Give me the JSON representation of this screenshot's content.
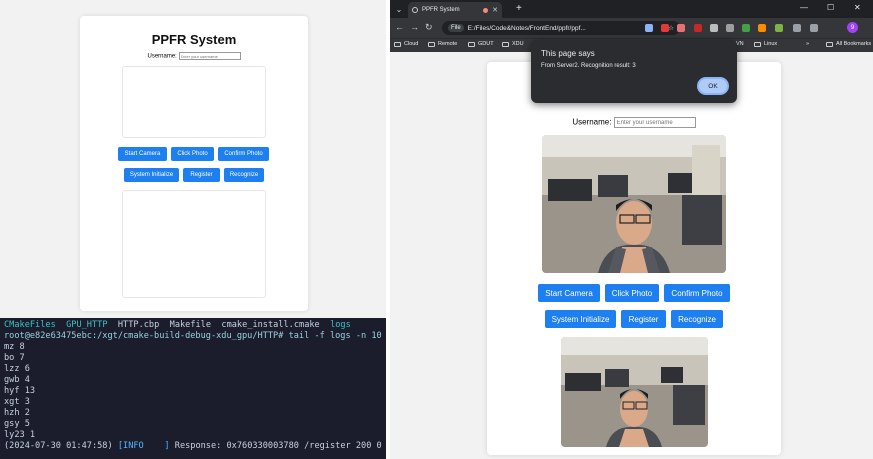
{
  "left_app": {
    "title": "PPFR System",
    "username_label": "Username:",
    "username_placeholder": "Enter your username",
    "buttons": {
      "start_camera": "Start Camera",
      "click_photo": "Click Photo",
      "confirm_photo": "Confirm Photo",
      "system_initialize": "System Initialize",
      "register": "Register",
      "recognize": "Recognize"
    }
  },
  "terminal": {
    "ls_items": [
      "CMakeFiles",
      "GPU_HTTP",
      "HTTP.cbp",
      "Makefile",
      "cmake_install.cmake",
      "logs"
    ],
    "prompt": "root@e82e63475ebc:/xgt/cmake-build-debug-xdu_gpu/HTTP# tail -f logs -n 10",
    "lines": [
      "mz 8",
      "bo 7",
      "lzz 6",
      "gwb 4",
      "hyf 13",
      "xgt 3",
      "hzh 2",
      "gsy 5",
      "ly23 1"
    ],
    "last_line": {
      "timestamp": "(2024-07-30 01:47:58)",
      "level": "[INFO    ]",
      "message": " Response: 0x760330003780 /register 200 0"
    }
  },
  "browser": {
    "tab_title": "PPFR System",
    "address_chip": "File",
    "url": "E:/Files/Code&Notes/FrontEnd/ppfr/ppf...",
    "bookmarks": [
      "Cloud",
      "Remote",
      "GDUT",
      "XDU",
      "VN",
      "Linux"
    ],
    "bookmarks_overflow": "»",
    "all_bookmarks": "All Bookmarks",
    "profile_initial": "9"
  },
  "page": {
    "username_label": "Username:",
    "username_placeholder": "Enter your username",
    "buttons": {
      "start_camera": "Start Camera",
      "click_photo": "Click Photo",
      "confirm_photo": "Confirm Photo",
      "system_initialize": "System Initialize",
      "register": "Register",
      "recognize": "Recognize"
    }
  },
  "dialog": {
    "title": "This page says",
    "message": "From Server2. Recognition result: 3",
    "ok_label": "OK"
  },
  "colors": {
    "button_blue": "#1e7ff0",
    "terminal_bg": "#1b1d2d",
    "browser_chrome": "#35363a"
  }
}
